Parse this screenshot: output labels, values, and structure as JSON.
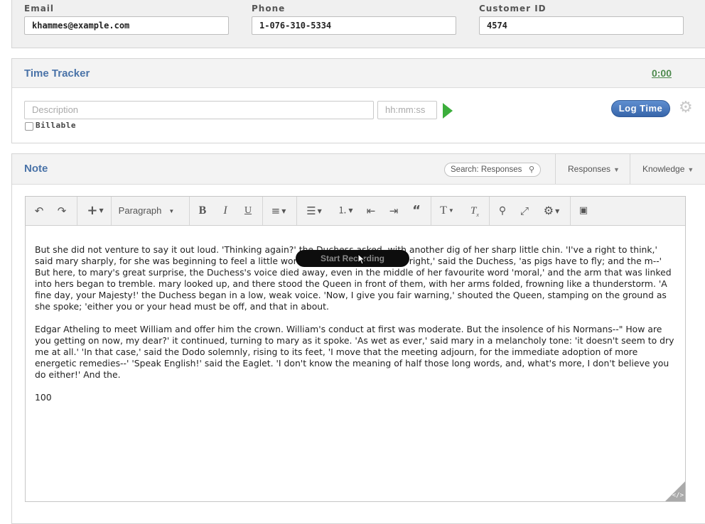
{
  "contact": {
    "email": {
      "label": "Email",
      "value": "khammes@example.com"
    },
    "phone": {
      "label": "Phone",
      "value": "1-076-310-5334"
    },
    "customer_id": {
      "label": "Customer ID",
      "value": "4574"
    }
  },
  "time_tracker": {
    "title": "Time Tracker",
    "timer": "0:00",
    "description_placeholder": "Description",
    "duration_placeholder": "hh:mm:ss",
    "billable_label": "Billable",
    "log_time_label": "Log Time",
    "icons": [
      "play-icon",
      "gear-icon"
    ]
  },
  "note": {
    "title": "Note",
    "search_placeholder": "Search: Responses",
    "responses_label": "Responses",
    "knowledge_label": "Knowledge",
    "toolbar": {
      "paragraph_label": "Paragraph",
      "icons": [
        "undo-icon",
        "redo-icon",
        "insert-icon",
        "bold-icon",
        "italic-icon",
        "underline-icon",
        "align-icon",
        "bullet-list-icon",
        "numbered-list-icon",
        "outdent-icon",
        "indent-icon",
        "quote-icon",
        "text-format-icon",
        "clear-format-icon",
        "search-icon",
        "fullscreen-icon",
        "settings-icon",
        "save-icon"
      ]
    },
    "content": {
      "p1": "But she did not venture to say it out loud. 'Thinking again?' the Duchess asked, with another dig of her sharp little chin. 'I've a right to think,' said mary sharply, for she was beginning to feel a little worried. 'Just about as much right,' said the Duchess, 'as pigs have to fly; and the m--' But here, to mary's great surprise, the Duchess's voice died away, even in the middle of her favourite word 'moral,' and the arm that was linked into hers began to tremble. mary looked up, and there stood the Queen in front of them, with her arms folded, frowning like a thunderstorm. 'A fine day, your Majesty!' the Duchess began in a low, weak voice. 'Now, I give you fair warning,' shouted the Queen, stamping on the ground as she spoke; 'either you or your head must be off, and that in about.",
      "p2": "Edgar Atheling to meet William and offer him the crown. William's conduct at first was moderate. But the insolence of his Normans--\" How are you getting on now, my dear?' it continued, turning to mary as it spoke. 'As wet as ever,' said mary in a melancholy tone: 'it doesn't seem to dry me at all.' 'In that case,' said the Dodo solemnly, rising to its feet, 'I move that the meeting adjourn, for the immediate adoption of more energetic remedies--' 'Speak English!' said the Eaglet. 'I don't know the meaning of half those long words, and, what's more, I don't believe you do either!' And the.",
      "p3": "100"
    },
    "overlay": {
      "recording_label": "Start Recording"
    }
  },
  "colors": {
    "accent": "#4a73a8",
    "timer": "#4e8a4e",
    "play": "#3cae3c",
    "log_time": "#3765aa"
  }
}
